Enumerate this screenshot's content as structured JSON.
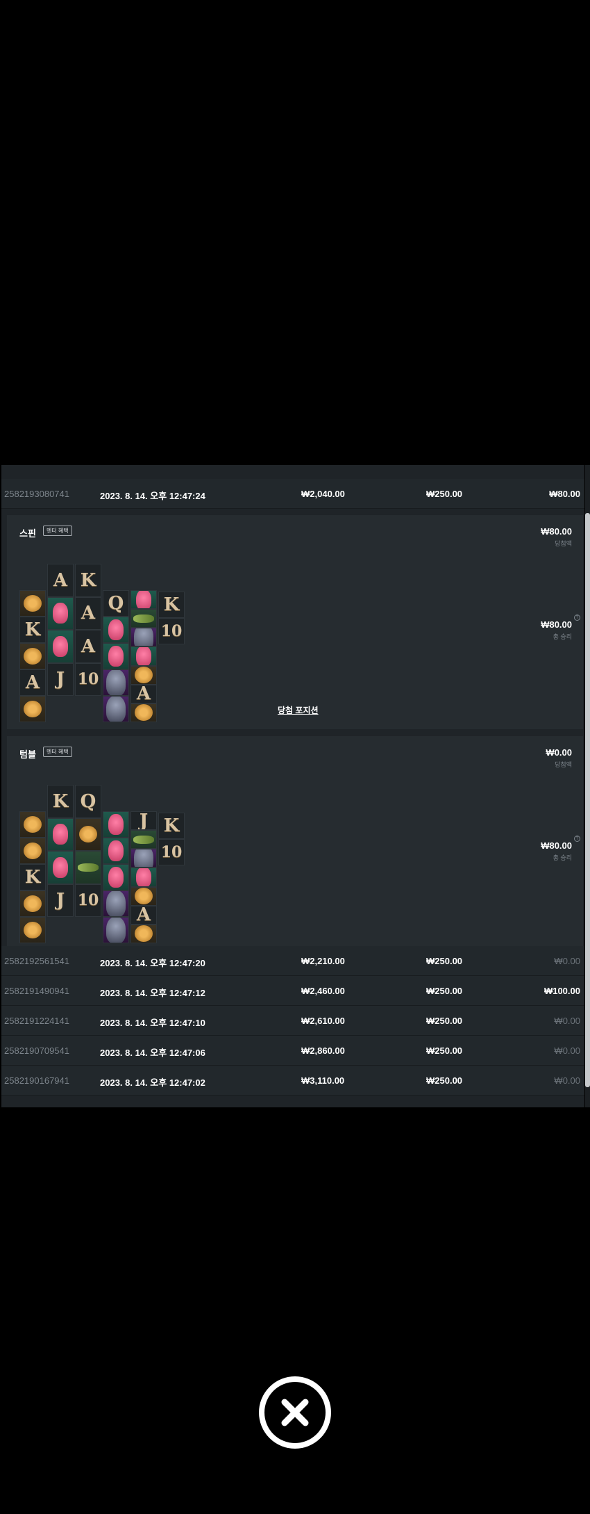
{
  "rows_before": [
    {
      "id": "2582193080741",
      "date": "2023. 8. 14. 오후 12:47:24",
      "balance": "₩2,040.00",
      "bet": "₩250.00",
      "win": "₩80.00",
      "win_zero": false
    }
  ],
  "details": [
    {
      "label": "스핀",
      "badge": "멘터 혜택",
      "win_amount": "₩80.00",
      "win_label": "당첨액",
      "total_amount": "₩80.00",
      "total_label": "총 승리",
      "info_icon": "?",
      "link": "당첨 포지션",
      "grid": {
        "columns": [
          [
            "cheetah",
            "K",
            "cheetah",
            "A",
            "cheetah"
          ],
          [
            "A",
            "flamingo",
            "flamingo",
            "J"
          ],
          [
            "K",
            "A",
            "A",
            "10"
          ],
          [
            "Q",
            "flamingo",
            "flamingo",
            "gorilla",
            "gorilla"
          ],
          [
            "flamingo",
            "croc",
            "gorilla",
            "flamingo",
            "cheetah",
            "A",
            "cheetah"
          ],
          [
            "K",
            "10"
          ]
        ]
      }
    },
    {
      "label": "텀블",
      "badge": "멘터 혜택",
      "win_amount": "₩0.00",
      "win_label": "당첨액",
      "total_amount": "₩80.00",
      "total_label": "총 승리",
      "info_icon": "?",
      "grid": {
        "columns": [
          [
            "cheetah",
            "cheetah",
            "K",
            "cheetah",
            "cheetah"
          ],
          [
            "K",
            "flamingo",
            "flamingo",
            "J"
          ],
          [
            "Q",
            "cheetah",
            "croc",
            "10"
          ],
          [
            "flamingo",
            "flamingo",
            "flamingo",
            "gorilla",
            "gorilla"
          ],
          [
            "J",
            "croc",
            "gorilla",
            "flamingo",
            "cheetah",
            "A",
            "cheetah"
          ],
          [
            "K",
            "10"
          ]
        ]
      }
    }
  ],
  "rows_after": [
    {
      "id": "2582192561541",
      "date": "2023. 8. 14. 오후 12:47:20",
      "balance": "₩2,210.00",
      "bet": "₩250.00",
      "win": "₩0.00",
      "win_zero": true
    },
    {
      "id": "2582191490941",
      "date": "2023. 8. 14. 오후 12:47:12",
      "balance": "₩2,460.00",
      "bet": "₩250.00",
      "win": "₩100.00",
      "win_zero": false
    },
    {
      "id": "2582191224141",
      "date": "2023. 8. 14. 오후 12:47:10",
      "balance": "₩2,610.00",
      "bet": "₩250.00",
      "win": "₩0.00",
      "win_zero": true
    },
    {
      "id": "2582190709541",
      "date": "2023. 8. 14. 오후 12:47:06",
      "balance": "₩2,860.00",
      "bet": "₩250.00",
      "win": "₩0.00",
      "win_zero": true
    },
    {
      "id": "2582190167941",
      "date": "2023. 8. 14. 오후 12:47:02",
      "balance": "₩3,110.00",
      "bet": "₩250.00",
      "win": "₩0.00",
      "win_zero": true
    }
  ],
  "close_icon": "close-icon"
}
